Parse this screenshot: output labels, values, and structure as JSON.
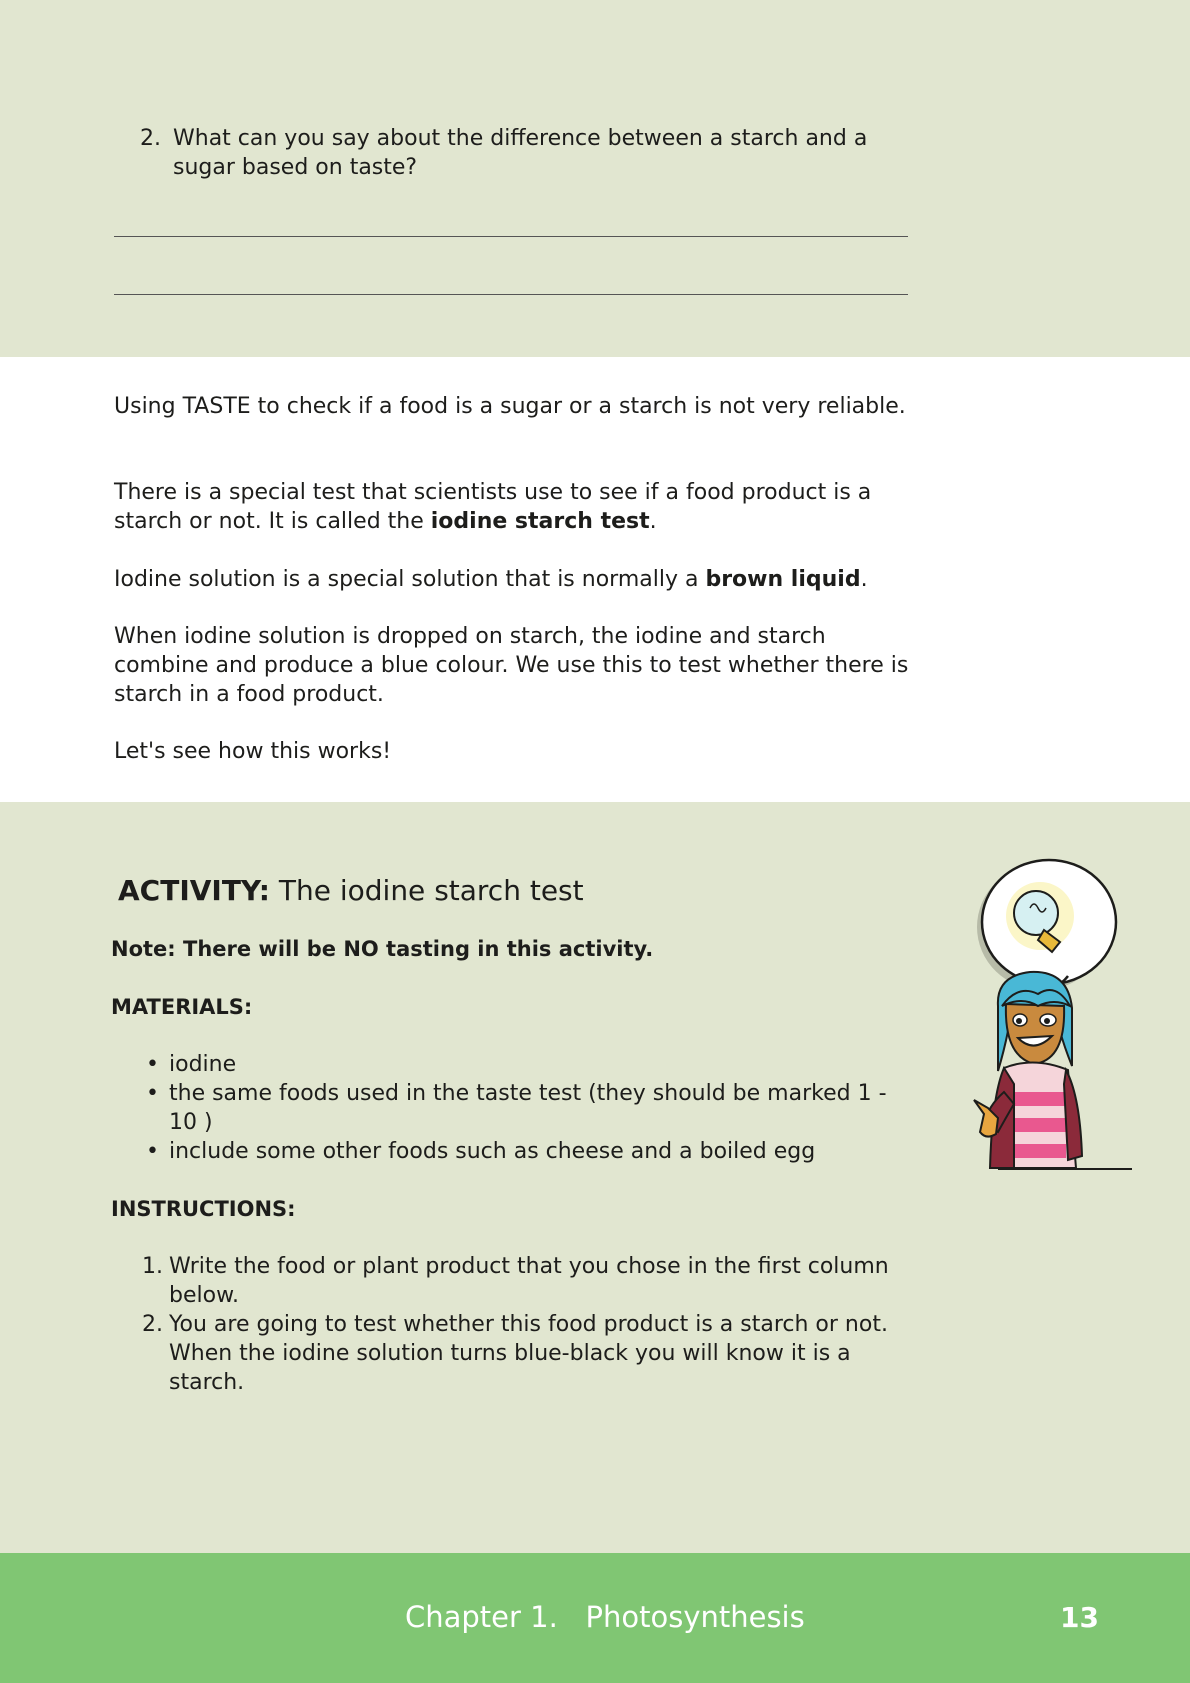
{
  "question": {
    "number": "2.",
    "text": "What can you say about the difference between a starch and a sugar based on taste?"
  },
  "info": {
    "p1": "Using TASTE to check if a food is a sugar or a starch is not very reliable.",
    "p2_before": "There is a special test that scientists use to see if a food product is a starch or not. It is called the ",
    "p2_bold": "iodine starch test",
    "p2_after": ".",
    "p3_before": "Iodine solution is a special solution that is normally a ",
    "p3_bold": "brown liquid",
    "p3_after": ".",
    "p4": "When iodine solution is dropped on starch, the iodine and starch combine and produce a blue colour. We use this to test whether there is starch in a food product.",
    "p5": "Let's see how this works!"
  },
  "activity": {
    "label": "ACTIVITY:",
    "title": "The iodine starch test",
    "note": "Note: There will be NO tasting in this activity.",
    "materials_heading": "MATERIALS:",
    "materials": [
      "iodine",
      "the same foods used in the taste test (they should be marked 1 - 10 )",
      "include some other foods such as cheese and a boiled egg"
    ],
    "instructions_heading": "INSTRUCTIONS:",
    "instructions": [
      {
        "num": "1.",
        "text": "Write the food or plant product that you chose in the first column below."
      },
      {
        "num": "2.",
        "text": "You are going to test whether this food product is a starch or not. When the iodine solution turns blue-black you will know it is a starch."
      }
    ]
  },
  "footer": {
    "chapter": "Chapter 1.   Photosynthesis",
    "page": "13"
  },
  "colors": {
    "page_green": "#e1e6d0",
    "footer_green": "#80c673",
    "hair": "#49b8d6",
    "jacket": "#8b2a3a"
  }
}
